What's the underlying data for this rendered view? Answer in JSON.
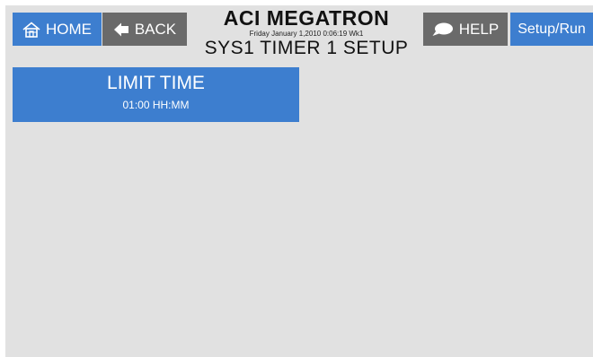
{
  "header": {
    "home_label": "HOME",
    "back_label": "BACK",
    "help_label": "HELP",
    "setup_run_label": "Setup/Run",
    "app_title": "ACI MEGATRON",
    "datetime": "Friday January 1,2010 0:06:19 Wk1",
    "screen_title": "SYS1 TIMER 1 SETUP"
  },
  "settings": {
    "limit_time": {
      "label": "LIMIT TIME",
      "value": "01:00 HH:MM"
    }
  },
  "icons": {
    "home": "home-icon",
    "back": "arrow-left-icon",
    "help": "speech-bubble-icon"
  },
  "colors": {
    "accent_blue": "#3d7ecf",
    "button_gray": "#6a6a6a",
    "background": "#e1e1e1"
  }
}
